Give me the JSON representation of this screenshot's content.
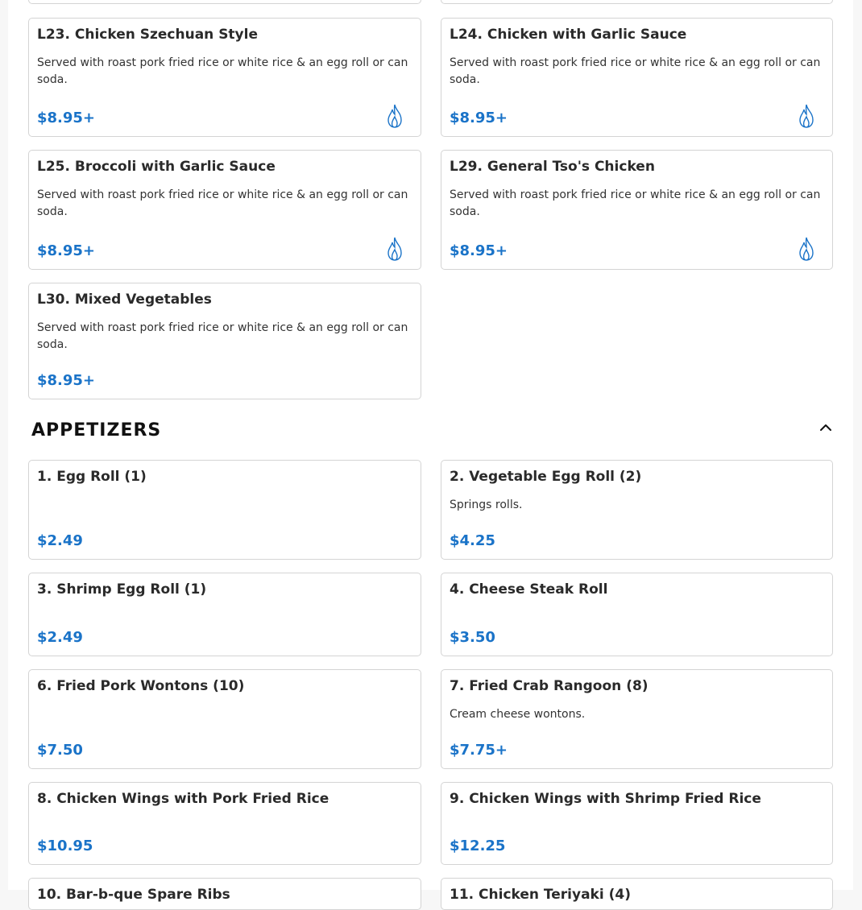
{
  "lunch_special": {
    "items": [
      {
        "title": "L23. Chicken Szechuan Style",
        "desc": "Served with roast pork fried rice or white rice & an egg roll or can soda.",
        "price": "$8.95+",
        "spicy": true
      },
      {
        "title": "L24. Chicken with Garlic Sauce",
        "desc": "Served with roast pork fried rice or white rice & an egg roll or can soda.",
        "price": "$8.95+",
        "spicy": true
      },
      {
        "title": "L25. Broccoli with Garlic Sauce",
        "desc": "Served with roast pork fried rice or white rice & an egg roll or can soda.",
        "price": "$8.95+",
        "spicy": true
      },
      {
        "title": "L29. General Tso's Chicken",
        "desc": "Served with roast pork fried rice or white rice & an egg roll or can soda.",
        "price": "$8.95+",
        "spicy": true
      },
      {
        "title": "L30. Mixed Vegetables",
        "desc": "Served with roast pork fried rice or white rice & an egg roll or can soda.",
        "price": "$8.95+",
        "spicy": false
      }
    ]
  },
  "appetizers": {
    "title": "APPETIZERS",
    "toggle_icon": "chevron-up-icon",
    "items": [
      {
        "title": "1. Egg Roll (1)",
        "desc": "",
        "price": "$2.49"
      },
      {
        "title": "2. Vegetable Egg Roll (2)",
        "desc": "Springs rolls.",
        "price": "$4.25"
      },
      {
        "title": "3. Shrimp Egg Roll (1)",
        "desc": "",
        "price": "$2.49"
      },
      {
        "title": "4. Cheese Steak Roll",
        "desc": "",
        "price": "$3.50"
      },
      {
        "title": "6. Fried Pork Wontons (10)",
        "desc": "",
        "price": "$7.50"
      },
      {
        "title": "7. Fried Crab Rangoon (8)",
        "desc": "Cream cheese wontons.",
        "price": "$7.75+"
      },
      {
        "title": "8. Chicken Wings with Pork Fried Rice",
        "desc": "",
        "price": "$10.95"
      },
      {
        "title": "9. Chicken Wings with Shrimp Fried Rice",
        "desc": "",
        "price": "$12.25"
      },
      {
        "title": "10. Bar-b-que Spare Ribs",
        "desc": "",
        "price": ""
      },
      {
        "title": "11. Chicken Teriyaki (4)",
        "desc": "",
        "price": ""
      }
    ]
  },
  "colors": {
    "price": "#1a73c8",
    "spicy_icon": "#1a73c8"
  }
}
